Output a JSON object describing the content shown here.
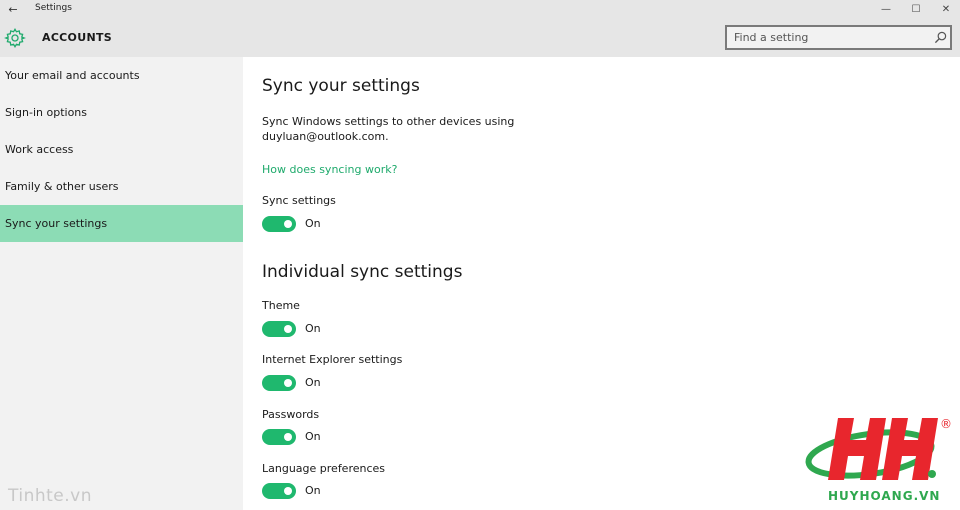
{
  "window": {
    "title": "Settings",
    "back_glyph": "←",
    "minimize_glyph": "—",
    "maximize_glyph": "☐",
    "close_glyph": "✕"
  },
  "header": {
    "icon": "gear-icon",
    "title": "ACCOUNTS",
    "search_placeholder": "Find a setting"
  },
  "sidebar": {
    "items": [
      {
        "label": "Your email and accounts",
        "active": false
      },
      {
        "label": "Sign-in options",
        "active": false
      },
      {
        "label": "Work access",
        "active": false
      },
      {
        "label": "Family & other users",
        "active": false
      },
      {
        "label": "Sync your settings",
        "active": true
      }
    ]
  },
  "main": {
    "heading": "Sync your settings",
    "description": "Sync Windows settings to other devices using duyluan@outlook.com.",
    "link": "How does syncing work?",
    "sync_settings": {
      "label": "Sync settings",
      "state": "On",
      "on": true
    },
    "individual_heading": "Individual sync settings",
    "individual": [
      {
        "label": "Theme",
        "state": "On",
        "on": true
      },
      {
        "label": "Internet Explorer settings",
        "state": "On",
        "on": true
      },
      {
        "label": "Passwords",
        "state": "On",
        "on": true
      },
      {
        "label": "Language preferences",
        "state": "On",
        "on": true
      }
    ]
  },
  "watermarks": {
    "left": "Tinhte.vn",
    "logo_text": "HUYHOANG.VN",
    "logo_mark": "®"
  },
  "colors": {
    "accent": "#1fb86e",
    "active_nav": "#8cdcb5",
    "link": "#1faa6c",
    "chrome": "#e6e6e6",
    "sidebar": "#f2f2f2"
  }
}
